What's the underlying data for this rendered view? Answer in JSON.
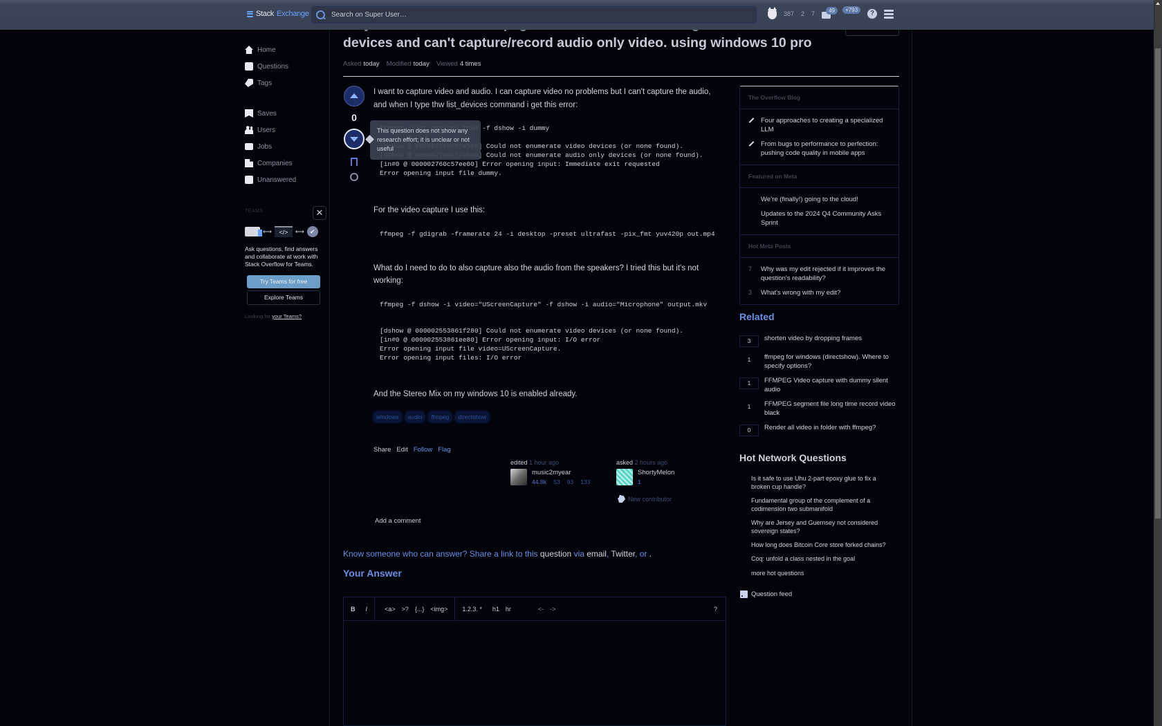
{
  "topbar": {
    "logo_part1": "Stack",
    "logo_part2": "Exchange",
    "search_placeholder": "Search on Super User…",
    "reputation": "387",
    "silver_badges": "2",
    "bronze_badges": "7",
    "inbox_count": "49",
    "achievements_count": "+793",
    "help_glyph": "?"
  },
  "leftnav": {
    "items": [
      {
        "label": "Home",
        "icon": "home-icon"
      },
      {
        "label": "Questions",
        "icon": "questions-icon"
      },
      {
        "label": "Tags",
        "icon": "tag-icon"
      },
      {
        "label": "Saves",
        "icon": "bookmark-icon"
      },
      {
        "label": "Users",
        "icon": "users-icon"
      },
      {
        "label": "Jobs",
        "icon": "briefcase-icon"
      },
      {
        "label": "Companies",
        "icon": "building-icon"
      },
      {
        "label": "Unanswered",
        "icon": "unanswered-icon"
      }
    ],
    "teams": {
      "title": "TEAMS",
      "close_glyph": "✕",
      "code_glyph": "</>",
      "check_glyph": "✔",
      "arrow_glyph": "⟷",
      "description": "Ask questions, find answers and collaborate at work with Stack Overflow for Teams.",
      "try_label": "Try Teams for free",
      "explore_label": "Explore Teams",
      "looking_prefix": "Looking for",
      "looking_link": "your Teams?"
    }
  },
  "question": {
    "title": "Why the command in ffmpeg with dshow is not working ? I can't list devices and can't capture/record audio only video. using windows 10 pro",
    "asked_label": "Asked",
    "asked_value": "today",
    "modified_label": "Modified",
    "modified_value": "today",
    "viewed_label": "Viewed",
    "viewed_value": "4 times",
    "score": "0",
    "downvote_tooltip": "This question does not show any research effort; it is unclear or not useful",
    "body": {
      "p1": "I want to capture video and audio. I can capture video no problems but I can't capture the audio, and when I type thw list_devices command i get this error:",
      "code1": "ffmpeg -list_devices true -f dshow -i dummy\n\n[dshow @ 000002760c57e580] Could not enumerate video devices (or none found).\n[dshow @ 000002760c57e580] Could not enumerate audio only devices (or none found).\n[in#0 @ 000002760c57ee00] Error opening input: Immediate exit requested\nError opening input file dummy.",
      "p2": "For the video capture I use this:",
      "code2": "ffmpeg -f gdigrab -framerate 24 -i desktop -preset ultrafast -pix_fmt yuv420p out.mp4",
      "p3": "What do I need to do to also capture also the audio from the speakers? I tried this but it's not working:",
      "code3": "ffmpeg -f dshow -i video=\"UScreenCapture\" -f dshow -i audio=\"Microphone\" output.mkv",
      "code4": "[dshow @ 000002553861f280] Could not enumerate video devices (or none found).\n[in#0 @ 000002553861ee80] Error opening input: I/O error\nError opening input file video=UScreenCapture.\nError opening input files: I/O error",
      "p4": "And the Stereo Mix on my windows 10 is enabled already."
    },
    "tags": [
      "windows",
      "audio",
      "ffmpeg",
      "directshow"
    ],
    "actions": {
      "share": "Share",
      "edit": "Edit",
      "follow": "Follow",
      "flag": "Flag"
    },
    "editor_sig": {
      "action": "edited",
      "time": "1 hour ago",
      "name": "music2myear",
      "reputation": "44.8k",
      "gold": "53",
      "silver": "93",
      "bronze": "133"
    },
    "owner_sig": {
      "action": "asked",
      "time": "2 hours ago",
      "name": "ShortyMelon",
      "reputation": "1",
      "new_contributor": "New contributor"
    },
    "add_comment": "Add a comment"
  },
  "share_prompt": {
    "part1": "Know someone who can answer? Share a link to this",
    "question_word": "question",
    "via": "via",
    "email": "email",
    "twitter": "Twitter",
    "or": "or",
    "end": "."
  },
  "answer_editor": {
    "heading": "Your Answer",
    "toolbar": {
      "bold": "B",
      "italic": "I",
      "link": "<a>",
      "quote": ">?",
      "code": "{...}",
      "image": "<img>",
      "lists": "1.2.3. *",
      "heading": "h1",
      "rule": "hr",
      "undo": "<-",
      "redo": "->",
      "help": "?"
    }
  },
  "sidebar": {
    "blog": {
      "title": "The Overflow Blog",
      "items": [
        "Four approaches to creating a specialized LLM",
        "From bugs to performance to perfection: pushing code quality in mobile apps"
      ]
    },
    "meta": {
      "title": "Featured on Meta",
      "items": [
        "We’re (finally!) going to the cloud!",
        "Updates to the 2024 Q4 Community Asks Sprint"
      ]
    },
    "hot_meta": {
      "title": "Hot Meta Posts",
      "items": [
        {
          "count": "7",
          "text": "Why was my edit rejected if it improves the question's readability?"
        },
        {
          "count": "3",
          "text": "What's wrong with my edit?"
        }
      ]
    },
    "related": {
      "title": "Related",
      "items": [
        {
          "count": "3",
          "text": "shorten video by dropping frames",
          "answered": true
        },
        {
          "count": "1",
          "text": "ffmpeg for windows (directshow). Where to specify options?",
          "answered": false
        },
        {
          "count": "1",
          "text": "FFMPEG Video capture with dummy silent audio",
          "answered": true
        },
        {
          "count": "1",
          "text": "FFMPEG segment file long time record video black",
          "answered": false
        },
        {
          "count": "0",
          "text": "Render all video in folder with ffmpeg?",
          "answered": true
        }
      ]
    },
    "hot_network": {
      "title": "Hot Network Questions",
      "items": [
        "Is it safe to use Uhu 2-part epoxy glue to fix a broken cup handle?",
        "Fundamental group of the complement of a codimension two submanifold",
        "Why are Jersey and Guernsey not considered sovereign states?",
        "How long does Bitcoin Core store forked chains?",
        "Coq: unfold a class nested in the goal"
      ],
      "more": "more hot questions"
    },
    "feed_label": "Question feed"
  }
}
